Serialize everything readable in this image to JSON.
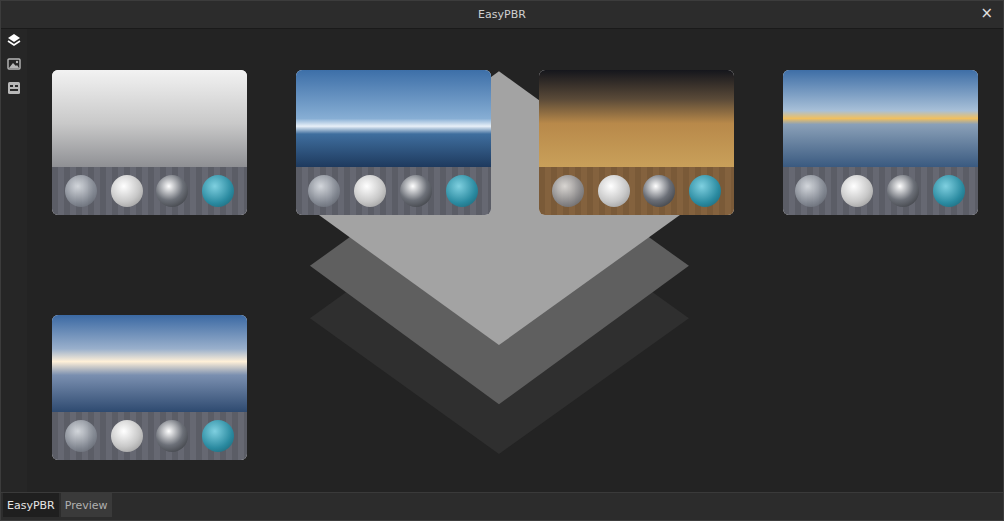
{
  "window": {
    "title": "EasyPBR",
    "close": "×"
  },
  "sidebar": {
    "items": [
      {
        "kind": "layers",
        "selected": true
      },
      {
        "kind": "image",
        "selected": false
      },
      {
        "kind": "panel",
        "selected": false
      }
    ]
  },
  "gallery": {
    "items": [
      {
        "selected": false
      },
      {
        "selected": false
      },
      {
        "selected": false
      },
      {
        "selected": false
      },
      {
        "selected": false
      }
    ]
  },
  "tabs": [
    {
      "label": "EasyPBR",
      "selected": true
    },
    {
      "label": "Preview",
      "selected": false
    }
  ]
}
